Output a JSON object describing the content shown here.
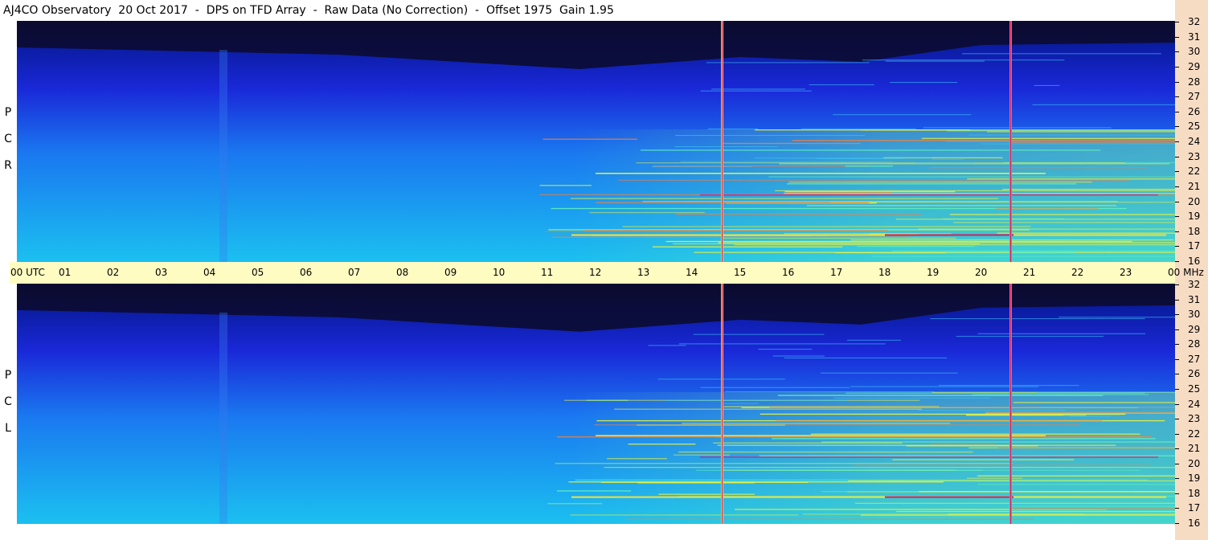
{
  "header": {
    "title": "AJ4CO Observatory  20 Oct 2017  -  DPS on TFD Array  -  Raw Data (No Correction)  -  Offset 1975  Gain 1.95"
  },
  "panels": [
    {
      "label_letters": [
        "P",
        "C",
        "R"
      ]
    },
    {
      "label_letters": [
        "P",
        "C",
        "L"
      ]
    }
  ],
  "time_axis": {
    "labels": [
      "00  UTC",
      "01",
      "02",
      "03",
      "04",
      "05",
      "06",
      "07",
      "08",
      "09",
      "10",
      "11",
      "12",
      "13",
      "14",
      "15",
      "16",
      "17",
      "18",
      "19",
      "20",
      "21",
      "22",
      "23",
      "00 MHz"
    ]
  },
  "chart_data": [
    {
      "type": "heatmap",
      "title": "AJ4CO Observatory  20 Oct 2017  -  DPS on TFD Array  -  Raw Data (No Correction)  -  Offset 1975  Gain 1.95",
      "panel": "R C P",
      "x_label": "UTC",
      "x_range_hours": [
        0,
        24
      ],
      "y_unit": "MHz",
      "y_range": [
        16,
        32
      ],
      "y_ticks": [
        "32",
        "31",
        "30",
        "29",
        "28",
        "27",
        "26",
        "25",
        "24",
        "23",
        "22",
        "21",
        "20",
        "19",
        "18",
        "17",
        "16"
      ],
      "colormap": [
        "#0b0b30",
        "#1a28d8",
        "#1a78f0",
        "#1bc0f0",
        "#80f0a0",
        "#f0f040",
        "#f07040",
        "#d02080"
      ]
    },
    {
      "type": "heatmap",
      "panel": "L C P",
      "x_label": "UTC",
      "x_range_hours": [
        0,
        24
      ],
      "y_unit": "MHz",
      "y_range": [
        16,
        32
      ],
      "y_ticks": [
        "32",
        "31",
        "30",
        "29",
        "28",
        "27",
        "26",
        "25",
        "24",
        "23",
        "22",
        "21",
        "20",
        "19",
        "18",
        "17",
        "16"
      ],
      "colormap": [
        "#0b0b30",
        "#1a28d8",
        "#1a78f0",
        "#1bc0f0",
        "#80f0a0",
        "#f0f040",
        "#f07040",
        "#d02080"
      ]
    }
  ]
}
